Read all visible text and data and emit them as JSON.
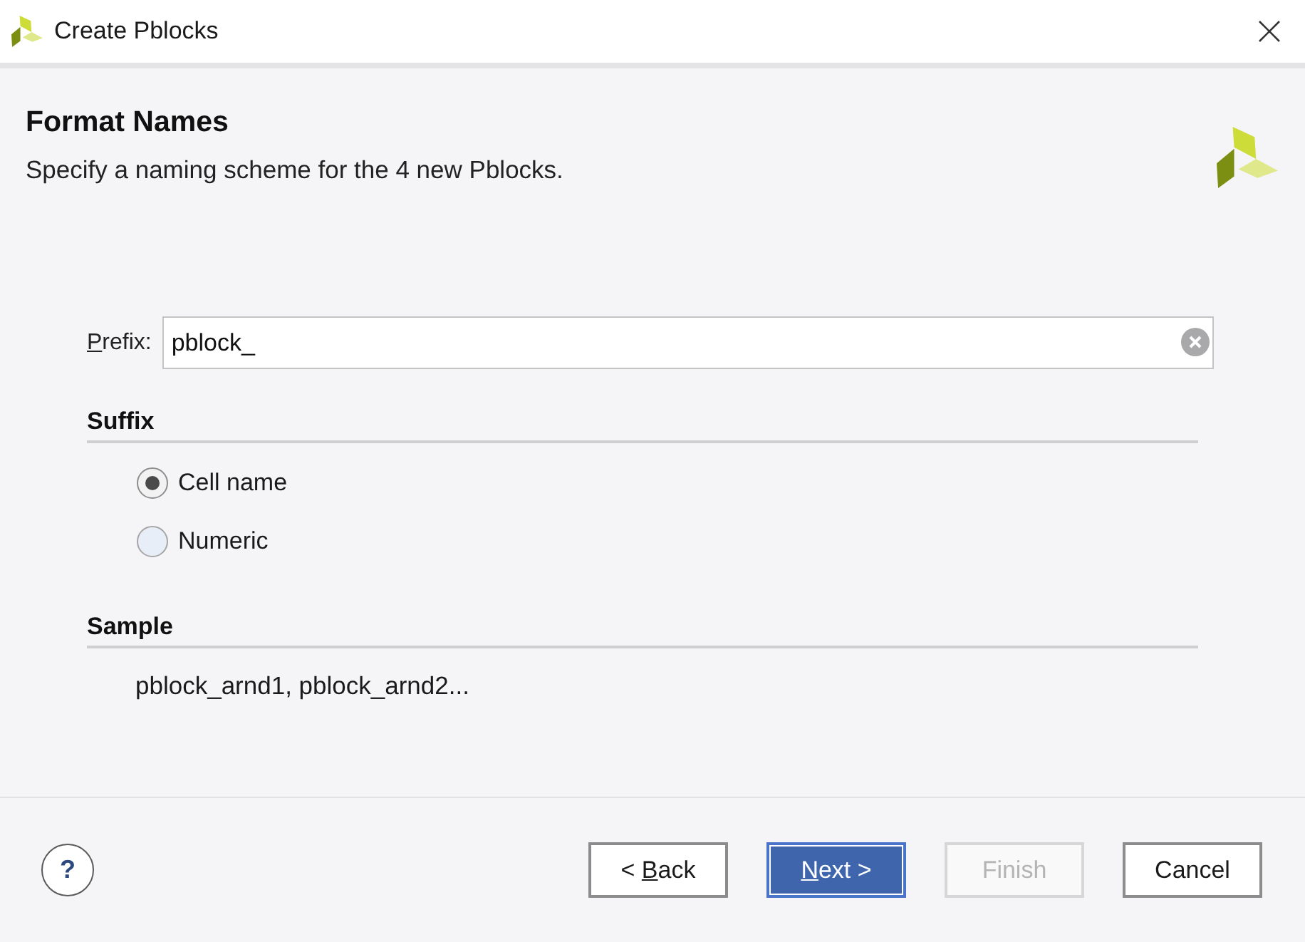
{
  "window": {
    "title": "Create Pblocks"
  },
  "header": {
    "title": "Format Names",
    "subtitle": "Specify a naming scheme for the 4 new Pblocks."
  },
  "prefix": {
    "label": "Prefix:",
    "mnemonic": true,
    "value": "pblock_"
  },
  "suffix": {
    "title": "Suffix",
    "options": [
      {
        "label": "Cell name",
        "selected": true
      },
      {
        "label": "Numeric",
        "selected": false
      }
    ]
  },
  "sample": {
    "title": "Sample",
    "text": "pblock_arnd1, pblock_arnd2..."
  },
  "help": {
    "label": "?"
  },
  "buttons": [
    {
      "label": "< Back",
      "mnemonic": true,
      "primary": false,
      "disabled": false
    },
    {
      "label": "Next >",
      "mnemonic": true,
      "primary": true,
      "disabled": false
    },
    {
      "label": "Finish",
      "mnemonic": false,
      "primary": false,
      "disabled": true
    },
    {
      "label": "Cancel",
      "mnemonic": false,
      "primary": false,
      "disabled": false
    }
  ]
}
